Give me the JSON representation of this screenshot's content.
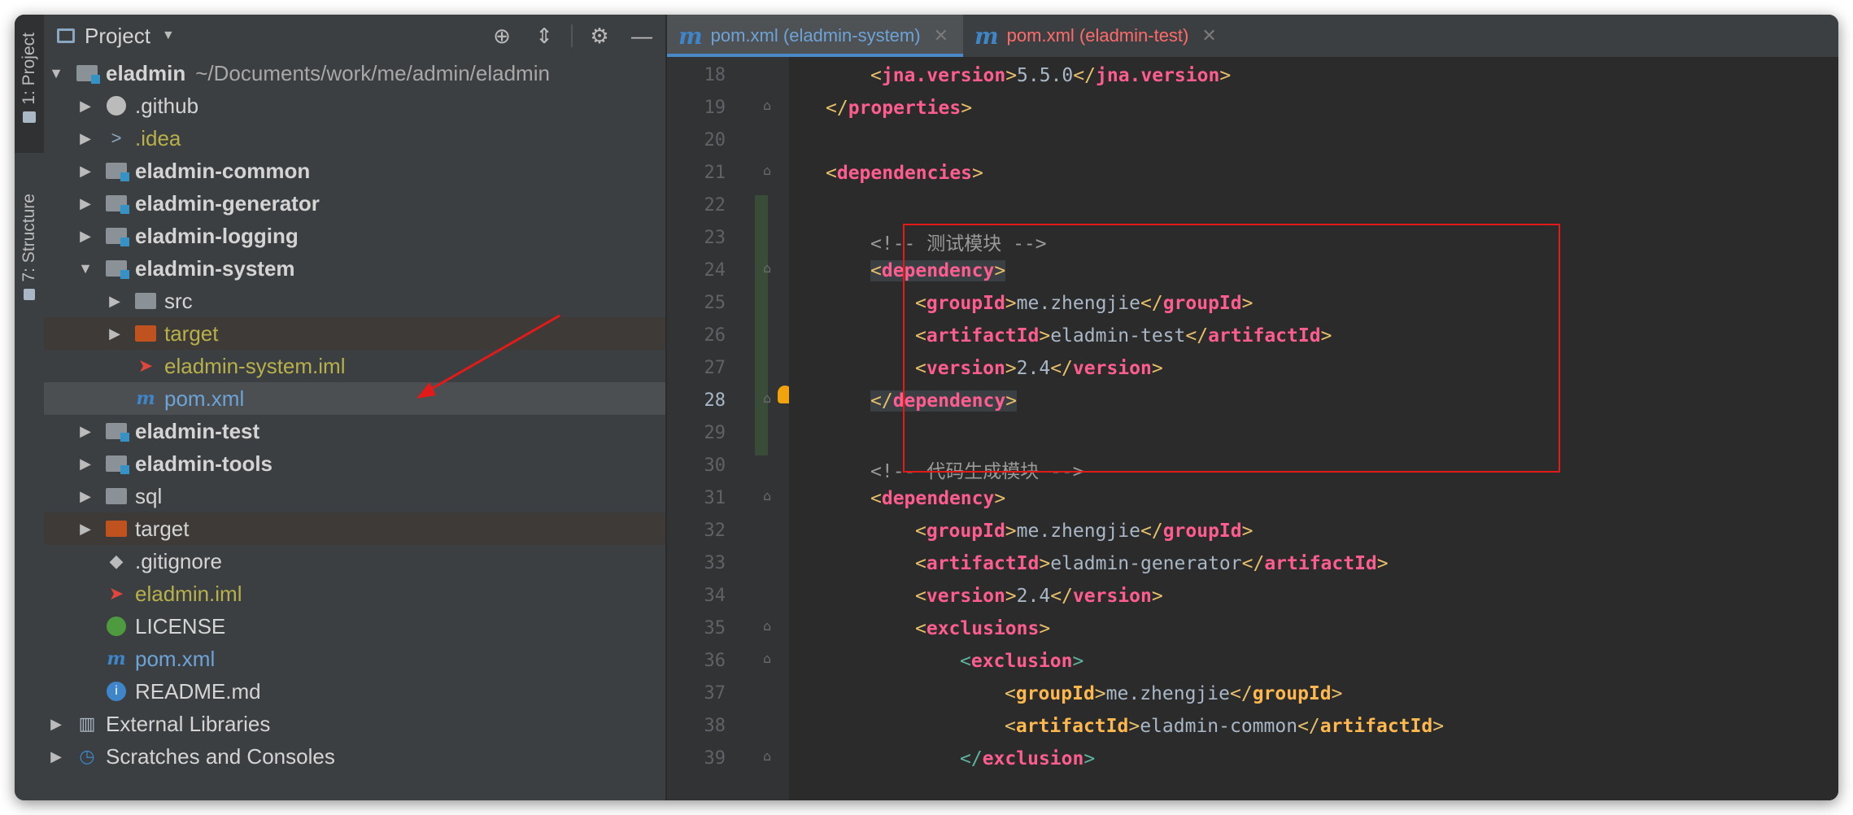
{
  "sidebar_tabs": [
    "1: Project",
    "7: Structure"
  ],
  "project_panel": {
    "title": "Project",
    "tree": [
      {
        "label": "eladmin",
        "path": "~/Documents/work/me/admin/eladmin"
      },
      {
        "label": ".github"
      },
      {
        "label": ".idea"
      },
      {
        "label": "eladmin-common"
      },
      {
        "label": "eladmin-generator"
      },
      {
        "label": "eladmin-logging"
      },
      {
        "label": "eladmin-system"
      },
      {
        "label": "src"
      },
      {
        "label": "target"
      },
      {
        "label": "eladmin-system.iml"
      },
      {
        "label": "pom.xml"
      },
      {
        "label": "eladmin-test"
      },
      {
        "label": "eladmin-tools"
      },
      {
        "label": "sql"
      },
      {
        "label": "target"
      },
      {
        "label": ".gitignore"
      },
      {
        "label": "eladmin.iml"
      },
      {
        "label": "LICENSE"
      },
      {
        "label": "pom.xml"
      },
      {
        "label": "README.md"
      },
      {
        "label": "External Libraries"
      },
      {
        "label": "Scratches and Consoles"
      }
    ]
  },
  "editor": {
    "tabs": [
      {
        "label": "pom.xml (eladmin-system)",
        "active": true
      },
      {
        "label": "pom.xml (eladmin-test)",
        "active": false
      }
    ],
    "line_numbers": [
      "18",
      "19",
      "20",
      "21",
      "22",
      "23",
      "24",
      "25",
      "26",
      "27",
      "28",
      "29",
      "30",
      "31",
      "32",
      "33",
      "34",
      "35",
      "36",
      "37",
      "38",
      "39"
    ],
    "text": {
      "jna_tag": "jna.version",
      "jna_value": "5.5.0",
      "properties": "properties",
      "dependencies": "dependencies",
      "comment1": "<!-- 测试模块 -->",
      "dependency": "dependency",
      "groupId": "groupId",
      "artifactId": "artifactId",
      "version": "version",
      "exclusions": "exclusions",
      "exclusion": "exclusion",
      "group_value": "me.zhengjie",
      "artifact_test": "eladmin-test",
      "version_value": "2.4",
      "comment2": "<!-- 代码生成模块 -->",
      "artifact_generator": "eladmin-generator",
      "artifact_common": "eladmin-common"
    }
  },
  "colors": {
    "tag": "#ff5d8f",
    "tag_nested": "#ffb84d",
    "annotation_box": "#e21a1a",
    "arrow": "#e21a1a"
  }
}
